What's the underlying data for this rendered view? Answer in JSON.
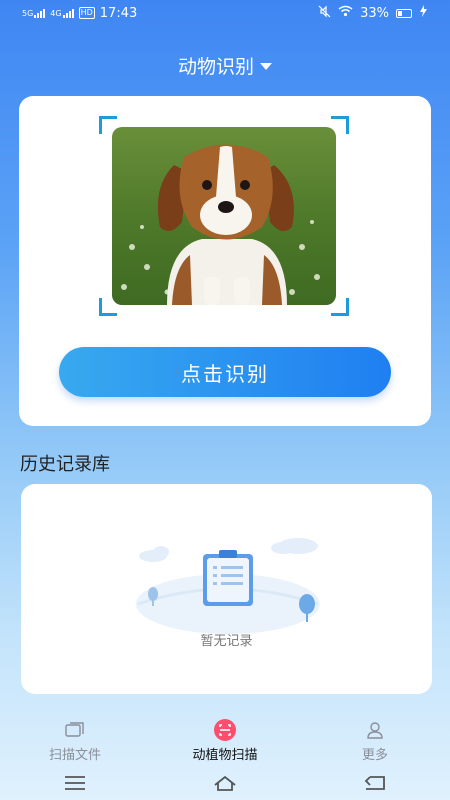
{
  "status_bar": {
    "net1": "5G",
    "net2": "4G",
    "hd": "HD",
    "time": "17:43",
    "battery": "33%"
  },
  "header": {
    "mode_label": "动物识别"
  },
  "scanner": {
    "image_subject": "beagle puppy",
    "button_label": "点击识别"
  },
  "history": {
    "title": "历史记录库",
    "empty_text": "暂无记录"
  },
  "bottom_nav": {
    "items": [
      {
        "label": "扫描文件",
        "icon": "files-icon"
      },
      {
        "label": "动植物扫描",
        "icon": "scan-icon"
      },
      {
        "label": "更多",
        "icon": "user-icon"
      }
    ]
  },
  "colors": {
    "accent": "#1f7ff1",
    "scan_active": "#ff4d6d",
    "corner": "#1e9bd9"
  }
}
